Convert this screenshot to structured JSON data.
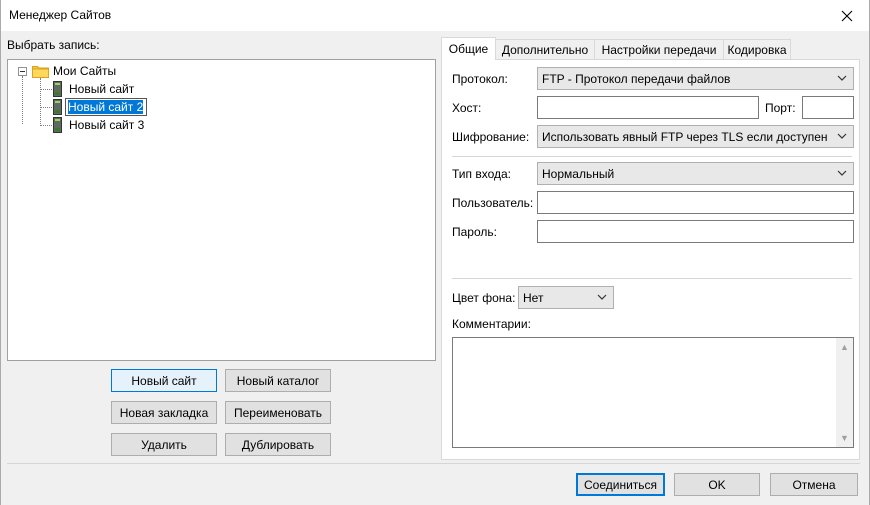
{
  "window": {
    "title": "Менеджер Сайтов"
  },
  "tree": {
    "select_label": "Выбрать запись:",
    "root_label": "Мои Сайты",
    "items": [
      {
        "label": "Новый сайт"
      },
      {
        "label": "Новый сайт 2",
        "editing": true
      },
      {
        "label": "Новый сайт 3"
      }
    ]
  },
  "tree_buttons": {
    "new_site": "Новый сайт",
    "new_folder": "Новый каталог",
    "new_bookmark": "Новая закладка",
    "rename": "Переименовать",
    "delete": "Удалить",
    "duplicate": "Дублировать"
  },
  "tabs": [
    "Общие",
    "Дополнительно",
    "Настройки передачи",
    "Кодировка"
  ],
  "general": {
    "protocol_label": "Протокол:",
    "protocol_value": "FTP - Протокол передачи файлов",
    "host_label": "Хост:",
    "host_value": "",
    "port_label": "Порт:",
    "port_value": "",
    "encryption_label": "Шифрование:",
    "encryption_value": "Использовать явный FTP через TLS если доступен",
    "logon_label": "Тип входа:",
    "logon_value": "Нормальный",
    "user_label": "Пользователь:",
    "user_value": "",
    "password_label": "Пароль:",
    "password_value": "",
    "bgcolor_label": "Цвет фона:",
    "bgcolor_value": "Нет",
    "comments_label": "Комментарии:",
    "comments_value": ""
  },
  "footer": {
    "connect": "Соединиться",
    "ok": "OK",
    "cancel": "Отмена"
  },
  "colors": {
    "selection": "#0078d7",
    "focus_border": "#0078d7"
  }
}
